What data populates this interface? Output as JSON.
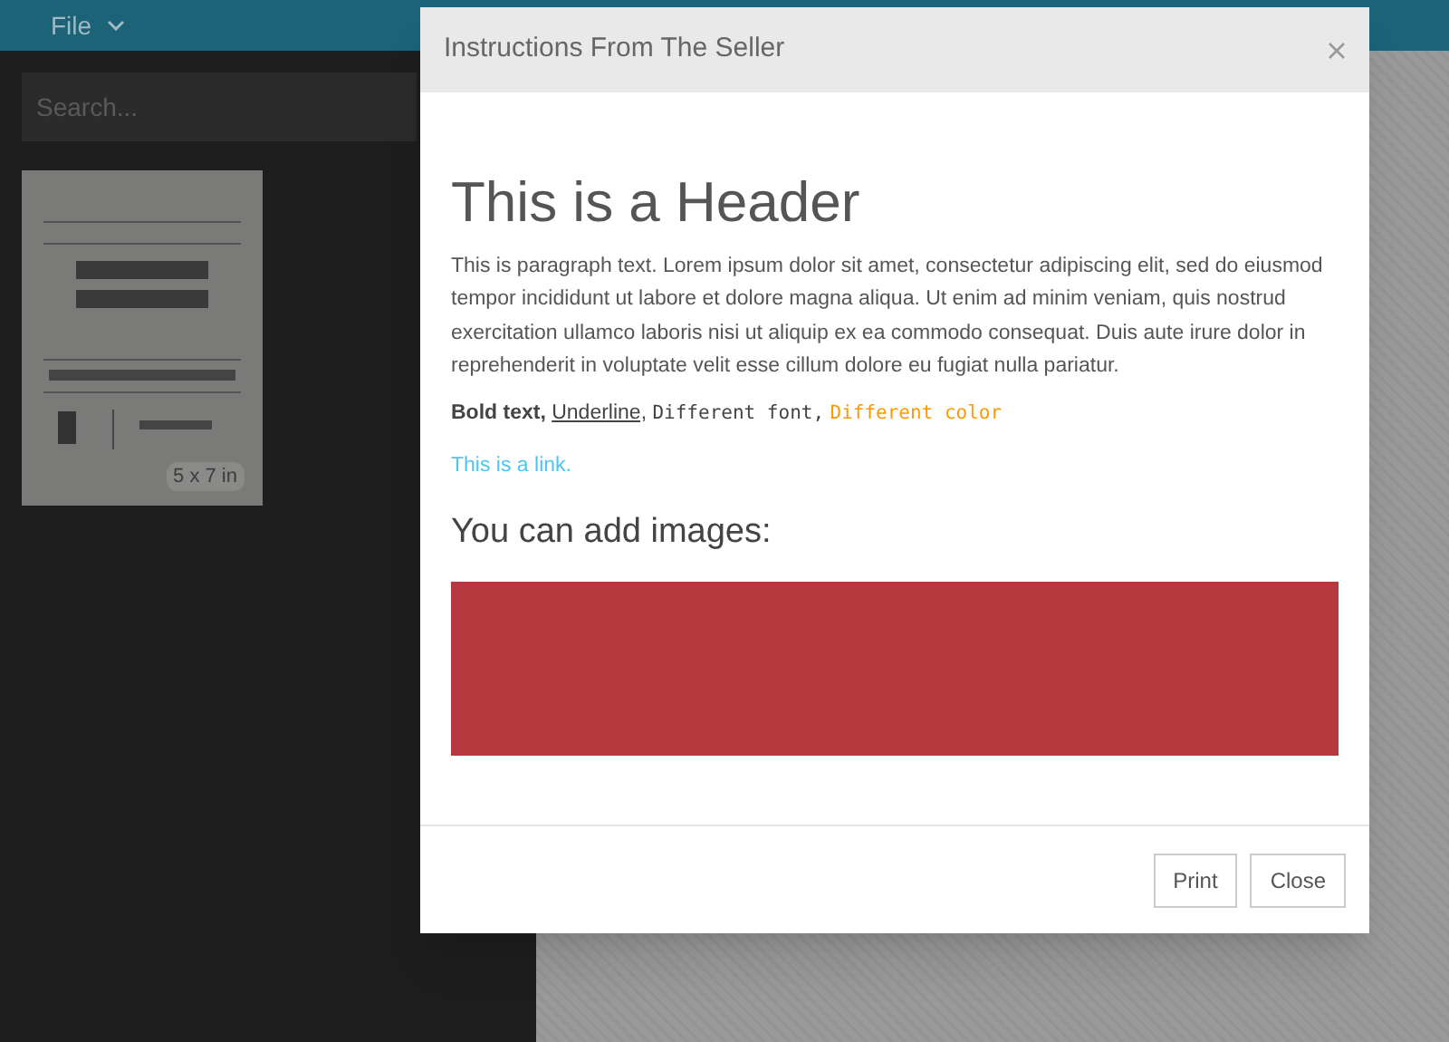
{
  "top_bar": {
    "menu": "File"
  },
  "sidebar": {
    "search": {
      "placeholder": "Search..."
    },
    "thumbnails": [
      {
        "kind": "picture",
        "size": "5 x 7 in"
      }
    ]
  },
  "dialog": {
    "title": "Instructions From The Seller",
    "header": "This is a Header",
    "paragraph": "This is paragraph text. Lorem ipsum dolor sit amet, consectetur adipiscing elit, sed do eiusmod tempor incididunt ut labore et dolore magna aliqua. Ut enim ad minim veniam, quis nostrud exercitation ullamco laboris nisi ut aliquip ex ea commodo consequat. Duis aute irure dolor in reprehenderit in voluptate velit esse cillum dolore eu fugiat nulla pariatur.",
    "styled_line": [
      {
        "kind": "bold",
        "text": "Bold text,"
      },
      {
        "kind": "underline",
        "text": "Underline,"
      },
      {
        "kind": "font",
        "text": "Different font,"
      },
      {
        "kind": "color",
        "text": "Different color",
        "color": "#ff9900"
      }
    ],
    "link": "This is a link.",
    "subheading": "You can add images:",
    "buttons": [
      "Print",
      "Close"
    ]
  }
}
